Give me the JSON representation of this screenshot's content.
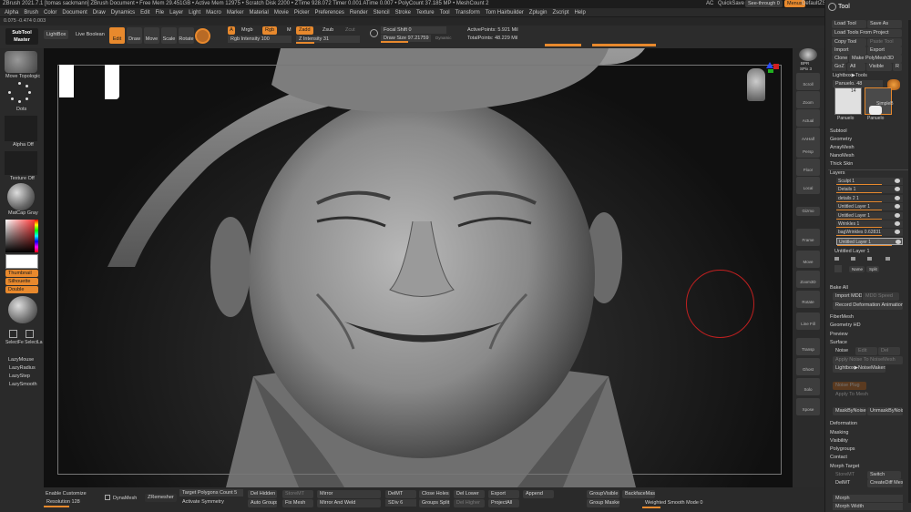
{
  "titlebar": {
    "text": "ZBrush 2021.7.1 [tomas sackmann]   ZBrush Document   • Free Mem 29.451GB • Active Mem 12975 • Scratch Disk 2200 • ZTime 928.072 Timer 0.001 ATime 0.007 • PolyCount 37.185 MP • MeshCount 2",
    "right_ac": "AC",
    "right_quicksave": "QuickSave",
    "right_seethrough": "See-through  0",
    "right_menus": "Menus",
    "right_script": "DefaultZScript"
  },
  "menu": [
    "Alpha",
    "Brush",
    "Color",
    "Document",
    "Draw",
    "Dynamics",
    "Edit",
    "File",
    "Layer",
    "Light",
    "Macro",
    "Marker",
    "Material",
    "Movie",
    "Picker",
    "Preferences",
    "Render",
    "Stencil",
    "Stroke",
    "Texture",
    "Tool",
    "Transform",
    "Tom Hairbuilder",
    "Zplugin",
    "Zscript",
    "Help"
  ],
  "coords": "0.075 -0.474 0.003",
  "toptool": {
    "subtool_master": "SubTool Master",
    "lightbox": "LightBox",
    "live_boolean": "Live Boolean",
    "edit": "Edit",
    "draw": "Draw",
    "move": "Move",
    "scale": "Scale",
    "rotate": "Rotate",
    "a": "A",
    "mrgb": "Mrgb",
    "rgb": "Rgb",
    "m": "M",
    "zadd": "Zadd",
    "zsub": "Zsub",
    "zcut": "Zcut",
    "rgb_intensity": "Rgb Intensity 100",
    "z_intensity": "Z Intensity 31",
    "focal_shift": "Focal Shift 0",
    "draw_size": "Draw Size 97.21759",
    "dynamic": "Dynamic",
    "active_points": "ActivePoints: 5.921 Mil",
    "total_points": "TotalPoints: 48.229 Mil"
  },
  "leftshelf": {
    "move_topologic": "Move Topologic",
    "dots": "Dots",
    "alpha_off": "Alpha Off",
    "texture_off": "Texture Off",
    "matcap": "MatCap Gray",
    "thumbnail": "Thumbnail",
    "silhouette": "Silhouette",
    "double": "Double",
    "selectfe": "SelectFe SelectLa",
    "lazymouse": "LazyMouse",
    "lazyradius": "LazyRadius",
    "lazystep": "LazyStep",
    "lazysmooth": "LazySmooth"
  },
  "rightshelf": [
    "BPR",
    "SPix 3",
    "Scroll",
    "Zoom",
    "Actual",
    "AAHalf",
    "Persp",
    "Floor",
    "Local",
    "Gizmo",
    "Frame",
    "Move",
    "Zoom3D",
    "Rotate",
    "Line Fill PolyF",
    "Transp",
    "Ghost",
    "Solo",
    "Xpose"
  ],
  "tray": {
    "title": "Tool",
    "load_tool": "Load Tool",
    "save_as": "Save As",
    "load_from_project": "Load Tools From Project",
    "copy_tool": "Copy Tool",
    "paste_tool": "Paste Tool",
    "import": "Import",
    "export": "Export",
    "clone": "Clone",
    "make_polymesh": "Make PolyMesh3D",
    "goz": "GoZ",
    "all": "All",
    "visible": "Visible",
    "r": "R",
    "lightbox_tools": "Lightbox▶Tools",
    "panuelo": "Panuelo. 48",
    "thumb_count": "14",
    "thumb1": "Panuelo",
    "thumb2": "Panuelo",
    "simple": "SimpleB",
    "subtool": "Subtool",
    "geometry": "Geometry",
    "arraymesh": "ArrayMesh",
    "nanomesh": "NanoMesh",
    "thickskin": "Thick Skin",
    "layers": "Layers",
    "layer_list": [
      {
        "name": "Sculpt 1",
        "selected": false
      },
      {
        "name": "Details 1",
        "selected": false
      },
      {
        "name": "details 2  1",
        "selected": false
      },
      {
        "name": "Untitled Layer 1",
        "selected": false
      },
      {
        "name": "Untitled Layer 1",
        "selected": false
      },
      {
        "name": "Wrinkles 1",
        "selected": false
      },
      {
        "name": "bagWrinkles  0.62831",
        "selected": false
      },
      {
        "name": "Untitled Layer 1",
        "selected": true
      }
    ],
    "current_layer": "Untitled Layer 1",
    "name": "Name",
    "split": "Split",
    "bake_all": "Bake All",
    "import_mdd": "Import MDD",
    "mdd_speed": "MDD Speed",
    "record_deform": "Record Deformation Animation",
    "fibermesh": "FiberMesh",
    "geometry_hd": "Geometry HD",
    "preview": "Preview",
    "surface": "Surface",
    "noise": "Noise",
    "edit": "Edit",
    "del": "Del",
    "apply_noise": "Apply Noise To NoiseMesh",
    "lightbox_noise": "Lightbox▶NoiseMakers",
    "noise_plug": "Noise Plug",
    "apply_to_mesh": "Apply To Mesh",
    "mask_by_noise": "MaskByNoise",
    "unmask_by_noise": "UnmaskByNoise",
    "deformation": "Deformation",
    "masking": "Masking",
    "visibility": "Visibility",
    "polygroups": "Polygroups",
    "contact": "Contact",
    "morph_target": "Morph Target",
    "storemt": "StoreMT",
    "switch": "Switch",
    "delmt": "DelMT",
    "creatediff": "CreateDiff Mesh",
    "morph": "Morph",
    "morph_width": "Morph Width"
  },
  "bottom": {
    "enable_customize": "Enable Customize",
    "resolution": "Resolution 128",
    "dynamesh": "DynaMesh",
    "zremesher": "ZRemesher",
    "target_polycount": "Target Polygons Count 5",
    "activate_symmetry": "Activate Symmetry",
    "del_hidden": "Del Hidden",
    "auto_groups": "Auto Groups",
    "storemt": "StoreMT",
    "fix_mesh": "Fix Mesh",
    "mirror": "Mirror",
    "mirror_weld": "Mirror And Weld",
    "delmt": "DelMT",
    "sdiv": "SDiv 6",
    "close_holes": "Close Holes",
    "groups_split": "Groups Split",
    "del_lower": "Del Lower",
    "del_higher": "Del Higher",
    "export": "Export",
    "projectall": "ProjectAll",
    "append": "Append",
    "groupvisible": "GroupVisible",
    "groups_masked": "Group Masked",
    "backfacemask": "BackfaceMask",
    "weighted_smooth": "Weighted Smooth Mode 0"
  }
}
